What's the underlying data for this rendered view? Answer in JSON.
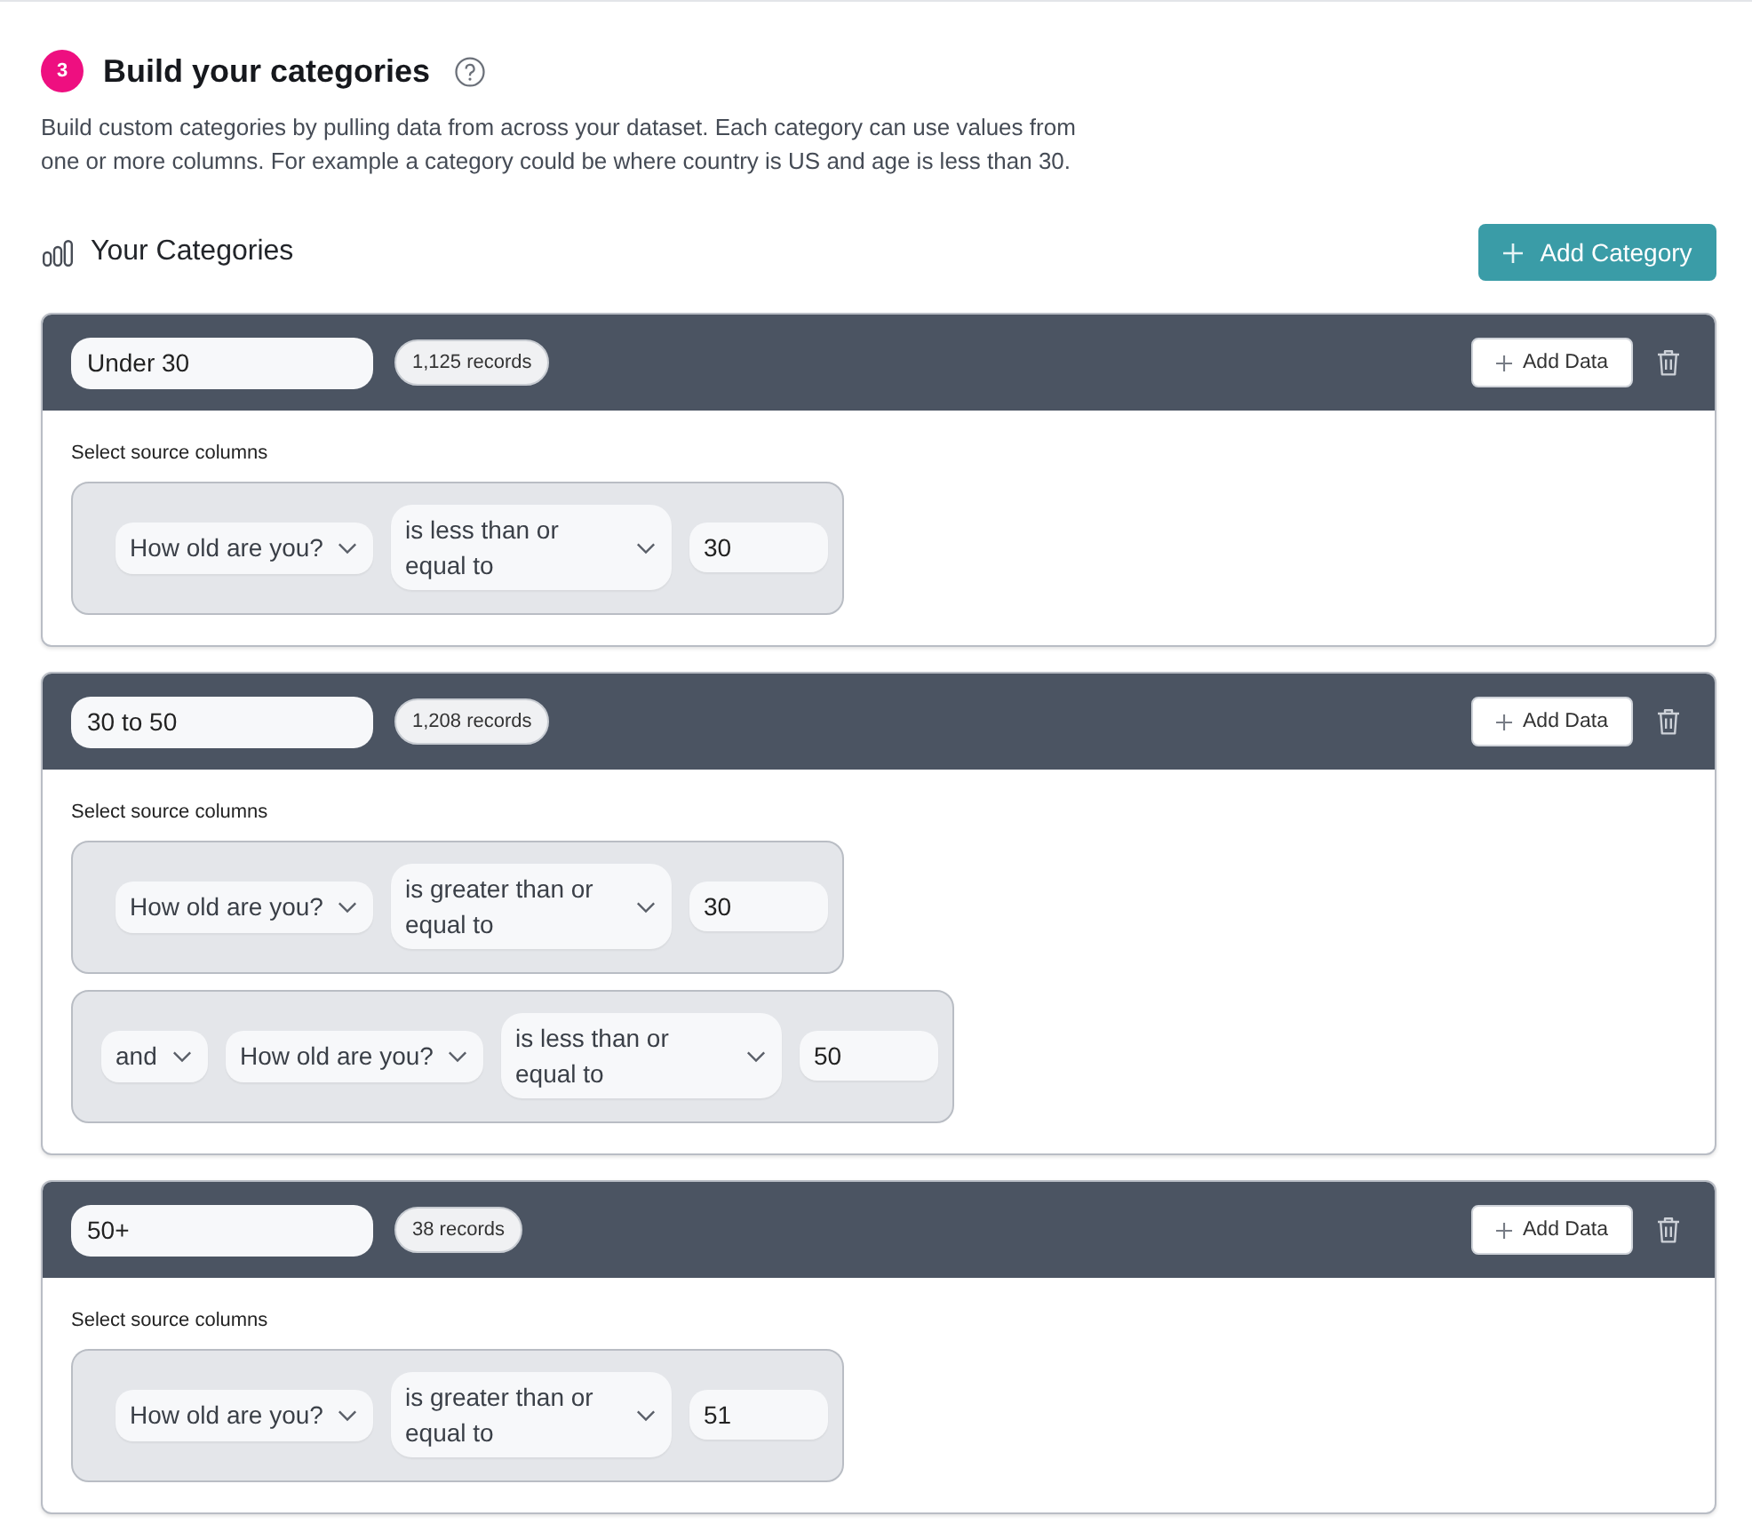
{
  "step": {
    "number": "3",
    "title": "Build your categories"
  },
  "description": "Build custom categories by pulling data from across your dataset. Each category can use values from one or more columns. For example a category could be where country is US and age is less than 30.",
  "categories_section": {
    "title": "Your Categories",
    "add_button": "Add Category"
  },
  "categories": [
    {
      "name": "Under 30",
      "record_count": "1,125 records",
      "add_data_button": "Add Data",
      "source_label": "Select source columns",
      "conditions": [
        {
          "kind": "first",
          "column": "How old are you?",
          "operator": "is less than or equal to",
          "value": "30"
        }
      ]
    },
    {
      "name": "30 to 50",
      "record_count": "1,208 records",
      "add_data_button": "Add Data",
      "source_label": "Select source columns",
      "conditions": [
        {
          "kind": "first",
          "column": "How old are you?",
          "operator": "is greater than or equal to",
          "value": "30"
        },
        {
          "kind": "joined",
          "connector": "and",
          "column": "How old are you?",
          "operator": "is less than or equal to",
          "value": "50"
        }
      ]
    },
    {
      "name": "50+",
      "record_count": "38 records",
      "add_data_button": "Add Data",
      "source_label": "Select source columns",
      "conditions": [
        {
          "kind": "first",
          "column": "How old are you?",
          "operator": "is greater than or equal to",
          "value": "51"
        }
      ]
    }
  ]
}
